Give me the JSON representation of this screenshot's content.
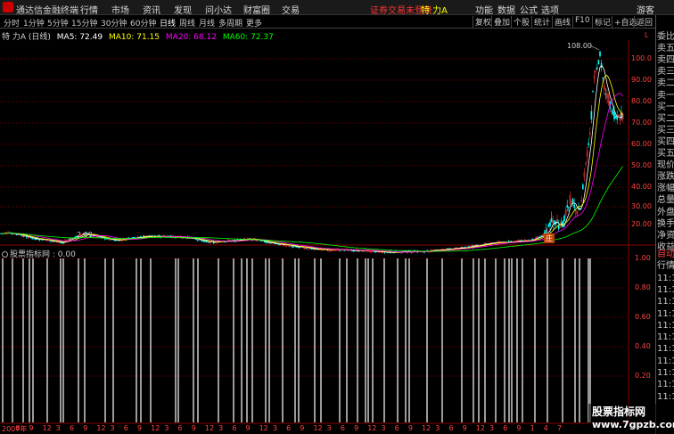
{
  "menubar": {
    "app_title": "通达信金融终端",
    "menus": [
      "行情",
      "市场",
      "资讯",
      "发现",
      "问小达",
      "财富圈",
      "交易"
    ],
    "login_status": "证券交易未登录",
    "stock_name": "特 力A",
    "right_menus": [
      "功能",
      "数据",
      "公式",
      "选项"
    ],
    "guest": "游客"
  },
  "periods": [
    "分时",
    "1分钟",
    "5分钟",
    "15分钟",
    "30分钟",
    "60分钟",
    "日线",
    "周线",
    "月线",
    "多周期",
    "更多"
  ],
  "active_period": "日线",
  "toolbar_right": [
    "复权",
    "叠加",
    "个股",
    "统计",
    "画线",
    "F10",
    "标记",
    "+自选",
    "返回"
  ],
  "main_chart": {
    "stock_label": "特 力A (日线)",
    "ma": [
      {
        "label": "MA5: 72.49",
        "color": "#ffffff"
      },
      {
        "label": "MA10: 71.15",
        "color": "#ffff00"
      },
      {
        "label": "MA20: 68.12",
        "color": "#ff00ff"
      },
      {
        "label": "MA60: 72.37",
        "color": "#00ff00"
      }
    ],
    "high_label": "108.00",
    "low_label": "2.69",
    "marker_label": "庄",
    "price_ticks": [
      "100.0",
      "90.00",
      "80.00",
      "70.00",
      "60.00",
      "50.00",
      "40.00",
      "30.00",
      "20.00"
    ],
    "corner_badge": "L"
  },
  "side_panel": {
    "items": [
      "委比",
      "卖五",
      "卖四",
      "卖三",
      "卖二",
      "卖一",
      "买一",
      "买二",
      "买三",
      "买四",
      "买五",
      "现价",
      "涨跌",
      "涨幅",
      "总量",
      "外盘",
      "换手",
      "净资",
      "收益"
    ],
    "lower_items": [
      "自动",
      "行情",
      "11:1",
      "11:1",
      "11:1",
      "11:1",
      "11:1",
      "11:1",
      "11:1",
      "11:1",
      "11:1",
      "11:1",
      "11:1"
    ]
  },
  "indicator": {
    "title": "股票指标网 : 0.00",
    "ticks": [
      "1.00",
      "0.80",
      "0.60",
      "0.40",
      "0.20"
    ]
  },
  "date_axis": [
    "2007年",
    "6",
    "9",
    "12",
    "3",
    "6",
    "9",
    "12",
    "3",
    "6",
    "9",
    "12",
    "3",
    "6",
    "9",
    "12",
    "3",
    "6",
    "9",
    "12",
    "3",
    "6",
    "9",
    "12",
    "3",
    "6",
    "9",
    "12",
    "3",
    "6",
    "9",
    "12",
    "3",
    "6",
    "9",
    "12",
    "3",
    "6",
    "9",
    "1",
    "4",
    "7"
  ],
  "watermark": {
    "line1": "股票指标网",
    "line2": "www.7gpzb.com"
  },
  "colors": {
    "up": "#ff3333",
    "down": "#00ffff",
    "grid": "#7a0000",
    "ma5": "#ffffff",
    "ma10": "#ffff00",
    "ma20": "#ff00ff",
    "ma60": "#00ff00"
  }
}
